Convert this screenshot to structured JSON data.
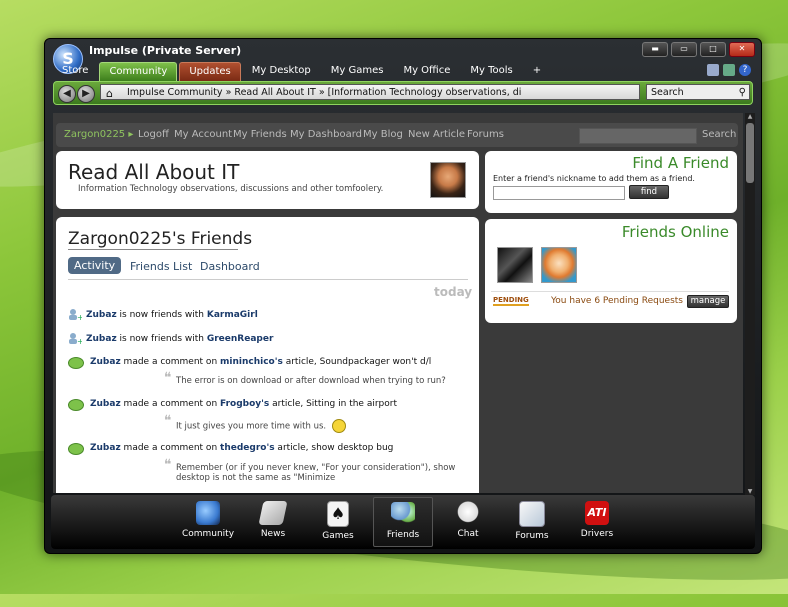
{
  "window": {
    "title": "Impulse (Private Server)",
    "logo": "S"
  },
  "tabs": [
    {
      "label": "Store"
    },
    {
      "label": "Community",
      "active": true
    },
    {
      "label": "Updates"
    },
    {
      "label": "My Desktop"
    },
    {
      "label": "My Games"
    },
    {
      "label": "My Office"
    },
    {
      "label": "My Tools"
    },
    {
      "label": "+"
    }
  ],
  "toolbar": {
    "back": "◀",
    "forward": "▶",
    "address": "Impulse Community » Read All About IT » [Information Technology observations, di",
    "search_label": "Search"
  },
  "sitenav": {
    "user": "Zargon0225 ▸",
    "links": [
      "Logoff",
      "My Account",
      "My Friends",
      "My Dashboard",
      "My Blog",
      "New Article",
      "Forums"
    ],
    "search": "Search"
  },
  "blog": {
    "title": "Read All About IT",
    "subtitle": "Information Technology observations, discussions and other tomfoolery."
  },
  "find_friend": {
    "title": "Find A Friend",
    "hint": "Enter a friend's nickname to add them as a friend.",
    "button": "find"
  },
  "friends": {
    "title": "Zargon0225's Friends",
    "subtabs": [
      "Activity",
      "Friends List",
      "Dashboard"
    ],
    "today": "today",
    "activity": [
      {
        "type": "friend",
        "user": "Zubaz",
        "text": " is now friends with ",
        "target": "KarmaGirl"
      },
      {
        "type": "friend",
        "user": "Zubaz",
        "text": " is now friends with ",
        "target": "GreenReaper"
      },
      {
        "type": "comment",
        "user": "Zubaz",
        "text": " made a comment on ",
        "target": "mininchico's",
        "rest": " article, Soundpackager won't d/l",
        "quote": "The error is on download or after download when trying to run?"
      },
      {
        "type": "comment",
        "user": "Zubaz",
        "text": " made a comment on ",
        "target": "Frogboy's",
        "rest": " article, Sitting in the airport",
        "quote": "It just gives you more time with us."
      },
      {
        "type": "comment",
        "user": "Zubaz",
        "text": " made a comment on ",
        "target": "thedegro's",
        "rest": " article, show desktop bug",
        "quote": "Remember (or if you never knew, \"For your consideration\"), show desktop is not the same as \"Minimize"
      }
    ]
  },
  "online": {
    "title": "Friends Online",
    "pending_badge": "PENDING",
    "pending_text": "You have 6 Pending Requests",
    "manage": "manage"
  },
  "taskbar": [
    {
      "label": "Community",
      "icon": "globe-icon",
      "color": "#3a7ad0"
    },
    {
      "label": "News",
      "icon": "newspaper-icon",
      "color": "#ccc"
    },
    {
      "label": "Games",
      "icon": "cards-icon",
      "color": "#eee"
    },
    {
      "label": "Friends",
      "icon": "people-icon",
      "color": "#6a9ad0",
      "active": true
    },
    {
      "label": "Chat",
      "icon": "chat-bubble-icon",
      "color": "#f2f2f2"
    },
    {
      "label": "Forums",
      "icon": "forum-icon",
      "color": "#d8e4f0"
    },
    {
      "label": "Drivers",
      "icon": "ati-logo-icon",
      "color": "#d01010"
    }
  ]
}
